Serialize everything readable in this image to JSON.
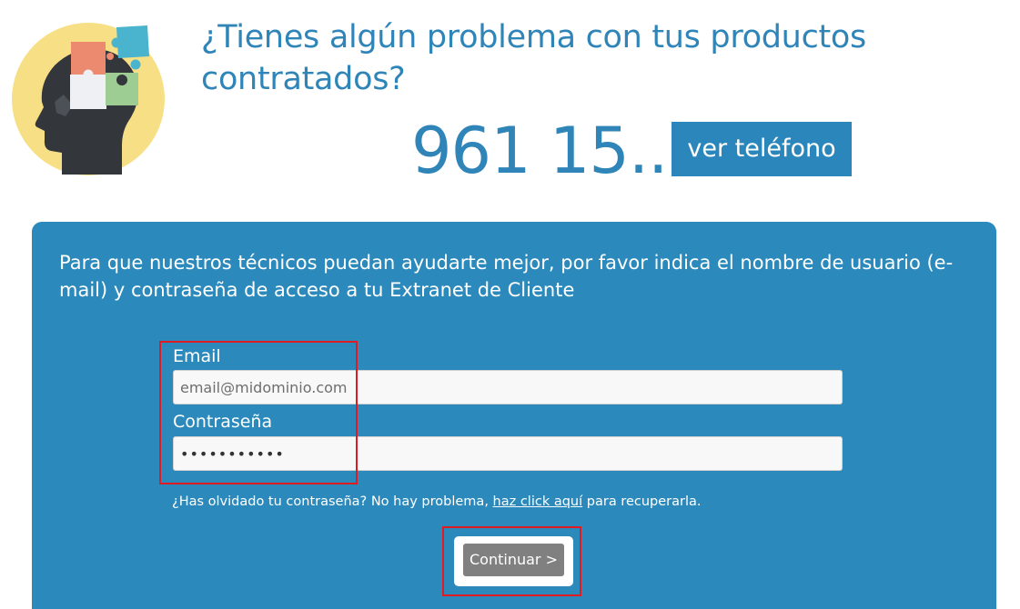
{
  "header": {
    "headline": "¿Tienes algún problema con tus productos contratados?",
    "phone_number": "961 15...",
    "phone_button_label": "ver teléfono"
  },
  "panel": {
    "intro": "Para que nuestros técnicos puedan ayudarte mejor, por favor indica el nombre de usuario (e-mail) y contraseña de acceso a tu Extranet de Cliente",
    "email_label": "Email",
    "email_placeholder": "email@midominio.com",
    "email_value": "",
    "password_label": "Contraseña",
    "password_value": "•••••••••••",
    "forgot_prefix": "¿Has olvidado tu contraseña? No hay problema, ",
    "forgot_link": "haz click aquí",
    "forgot_suffix": " para recuperarla.",
    "continue_label": "Continuar >"
  },
  "icons": {
    "illustration": "head-puzzle-icon"
  },
  "colors": {
    "brand_blue": "#2b89bb",
    "text_blue": "#2f84b8",
    "button_gray": "#808080",
    "highlight_red": "#e01b22"
  }
}
